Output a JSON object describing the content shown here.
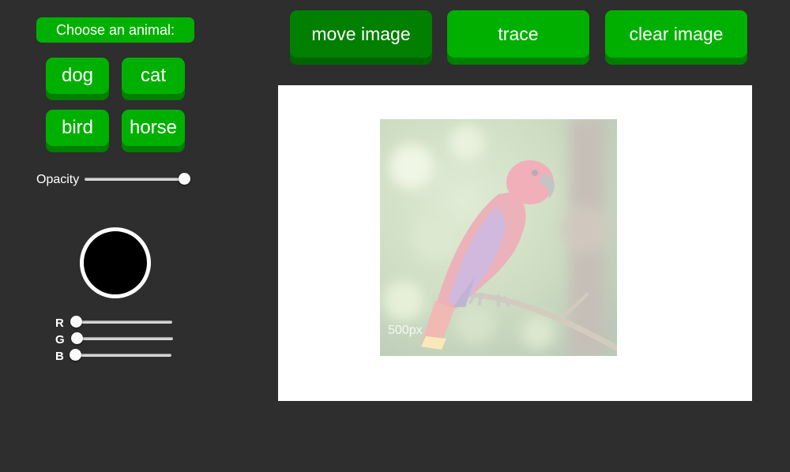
{
  "sidebar": {
    "choose_label": "Choose an animal:",
    "animals": [
      {
        "label": "dog"
      },
      {
        "label": "cat"
      },
      {
        "label": "bird"
      },
      {
        "label": "horse"
      }
    ],
    "opacity": {
      "label": "Opacity",
      "value": 1.0
    },
    "color": {
      "hex": "#000000",
      "r_label": "R",
      "g_label": "G",
      "b_label": "B",
      "r": 0,
      "g": 0,
      "b": 0
    }
  },
  "toolbar": {
    "move_label": "move image",
    "trace_label": "trace",
    "clear_label": "clear image",
    "active_tool": "move"
  },
  "canvas": {
    "image_subject": "parrot",
    "image_opacity": 0.35,
    "watermark": "500px"
  },
  "colors": {
    "button": "#00b000",
    "button_active": "#007f00",
    "background": "#2e2e2e"
  }
}
